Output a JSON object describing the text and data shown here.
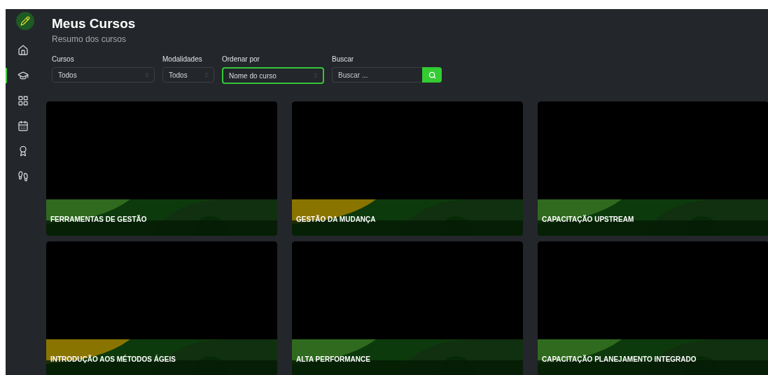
{
  "header": {
    "title": "Meus Cursos",
    "subtitle": "Resumo dos cursos"
  },
  "sidebar": {
    "items": [
      {
        "selected": false
      },
      {
        "selected": true
      },
      {
        "selected": false
      },
      {
        "selected": false
      },
      {
        "selected": false
      },
      {
        "selected": false
      }
    ]
  },
  "filters": [
    {
      "kind": "select",
      "label": "Cursos",
      "value": "Todos",
      "focused": false
    },
    {
      "kind": "select",
      "label": "Modalidades",
      "value": "Todos",
      "focused": false
    },
    {
      "kind": "select",
      "label": "Ordenar por",
      "value": "Nome do curso",
      "focused": true
    },
    {
      "kind": "search",
      "label": "Buscar",
      "placeholder": "Buscar ...",
      "focused": false
    }
  ],
  "courses": [
    {
      "title": "FERRAMENTAS DE GESTÃO",
      "color": "#2f6a1e"
    },
    {
      "title": "GESTÃO DA MUDANÇA",
      "color": "#8a7400"
    },
    {
      "title": "CAPACITAÇÃO UPSTREAM",
      "color": "#2f6a1e"
    },
    {
      "title": "INTRODUÇÃO AOS MÉTODOS ÁGEIS",
      "color": "#8a7400"
    },
    {
      "title": "ALTA PERFORMANCE",
      "color": "#2f6a1e"
    },
    {
      "title": "CAPACITAÇÃO PLANEJAMENTO INTEGRADO",
      "color": "#2f6a1e"
    }
  ]
}
